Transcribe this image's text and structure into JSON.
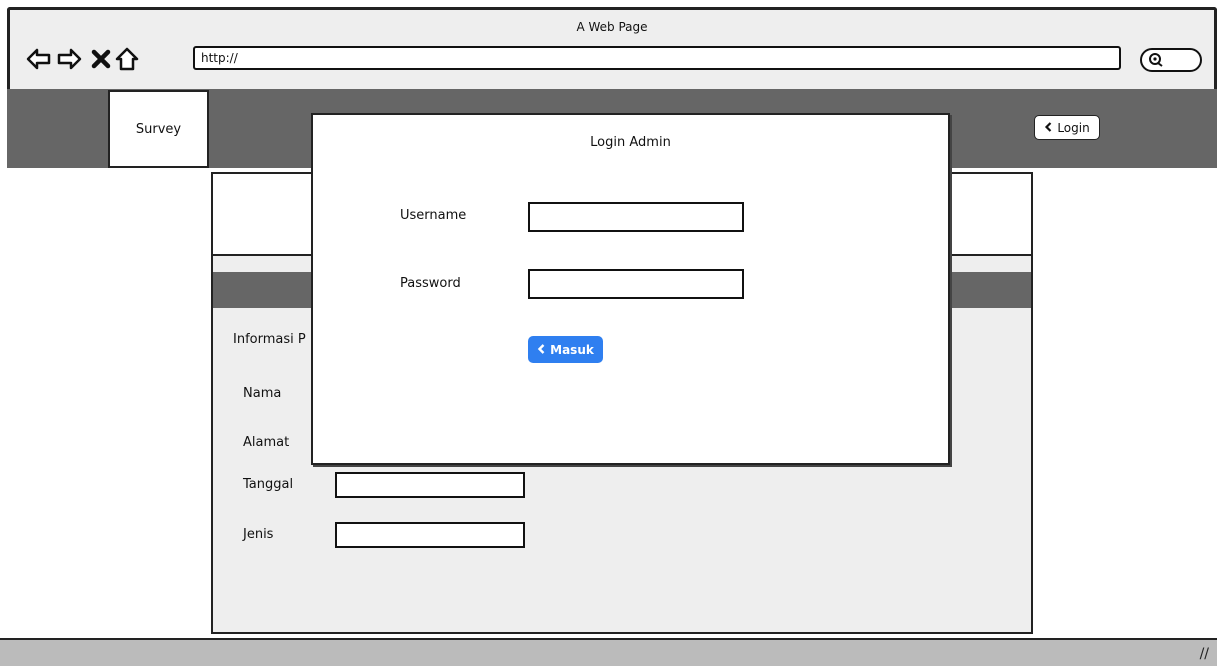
{
  "window": {
    "title": "A Web Page",
    "url": "http://"
  },
  "nav": {
    "survey_label": "Survey",
    "login_label": "Login"
  },
  "form": {
    "section_label": "Informasi P",
    "fields": [
      "Nama",
      "Alamat",
      "Tanggal",
      "Jenis"
    ]
  },
  "modal": {
    "title": "Login Admin",
    "username_label": "Username",
    "password_label": "Password",
    "submit_label": "Masuk"
  },
  "colors": {
    "accent": "#2f7ff0",
    "bar": "#666666",
    "panel": "#eeeeee"
  }
}
